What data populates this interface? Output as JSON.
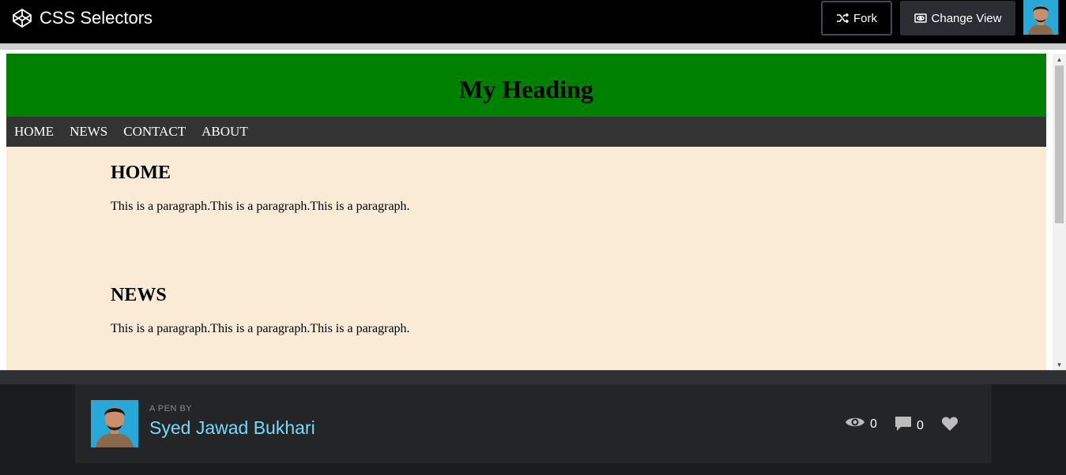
{
  "topbar": {
    "pen_title": "CSS Selectors",
    "fork_label": "Fork",
    "change_view_label": "Change View"
  },
  "preview": {
    "heading": "My Heading",
    "nav": [
      "HOME",
      "NEWS",
      "CONTACT",
      "ABOUT"
    ],
    "sections": [
      {
        "title": "HOME",
        "text": "This is a paragraph.This is a paragraph.This is a paragraph."
      },
      {
        "title": "NEWS",
        "text": "This is a paragraph.This is a paragraph.This is a paragraph."
      }
    ]
  },
  "footer": {
    "pen_by": "A PEN BY",
    "author": "Syed Jawad Bukhari",
    "views": "0",
    "comments": "0"
  },
  "colors": {
    "header_green": "#008000",
    "nav_bg": "#333333",
    "page_bg": "#faebd7",
    "author_link": "#76daff"
  },
  "icons": [
    "codepen-logo-icon",
    "fork-icon",
    "eye-icon",
    "comment-icon",
    "heart-icon"
  ]
}
